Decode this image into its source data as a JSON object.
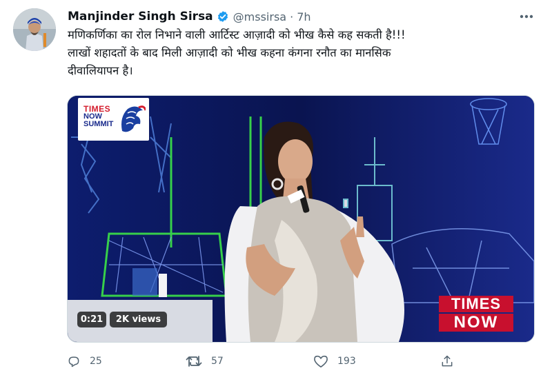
{
  "tweet": {
    "author_name": "Manjinder Singh Sirsa",
    "handle": "@mssirsa",
    "separator": "·",
    "time": "7h",
    "text_line_1": "मणिकर्णिका का रोल निभाने वाली आर्टिस्ट आज़ादी को भीख कैसे कह सकती है!!!",
    "text_line_2": "लाखों शहादतों के बाद मिली आज़ादी को भीख कहना कंगना रनौत का मानसिक",
    "text_line_3": "दीवालियापन है।"
  },
  "video": {
    "duration": "0:21",
    "views": "2K views",
    "logo_line_1": "TIMES",
    "logo_line_2": "NOW",
    "logo_line_3": "SUMMIT",
    "channel_line_1": "TIMES",
    "channel_line_2": "NOW"
  },
  "actions": {
    "replies": "25",
    "retweets": "57",
    "likes": "193"
  },
  "colors": {
    "verified": "#1d9bf0",
    "secondary_text": "#536471",
    "channel_red": "#c8102e",
    "stage_blue": "#0b1650"
  },
  "icons": [
    "verified-badge-icon",
    "more-options-icon",
    "reply-icon",
    "retweet-icon",
    "like-icon",
    "share-icon"
  ]
}
